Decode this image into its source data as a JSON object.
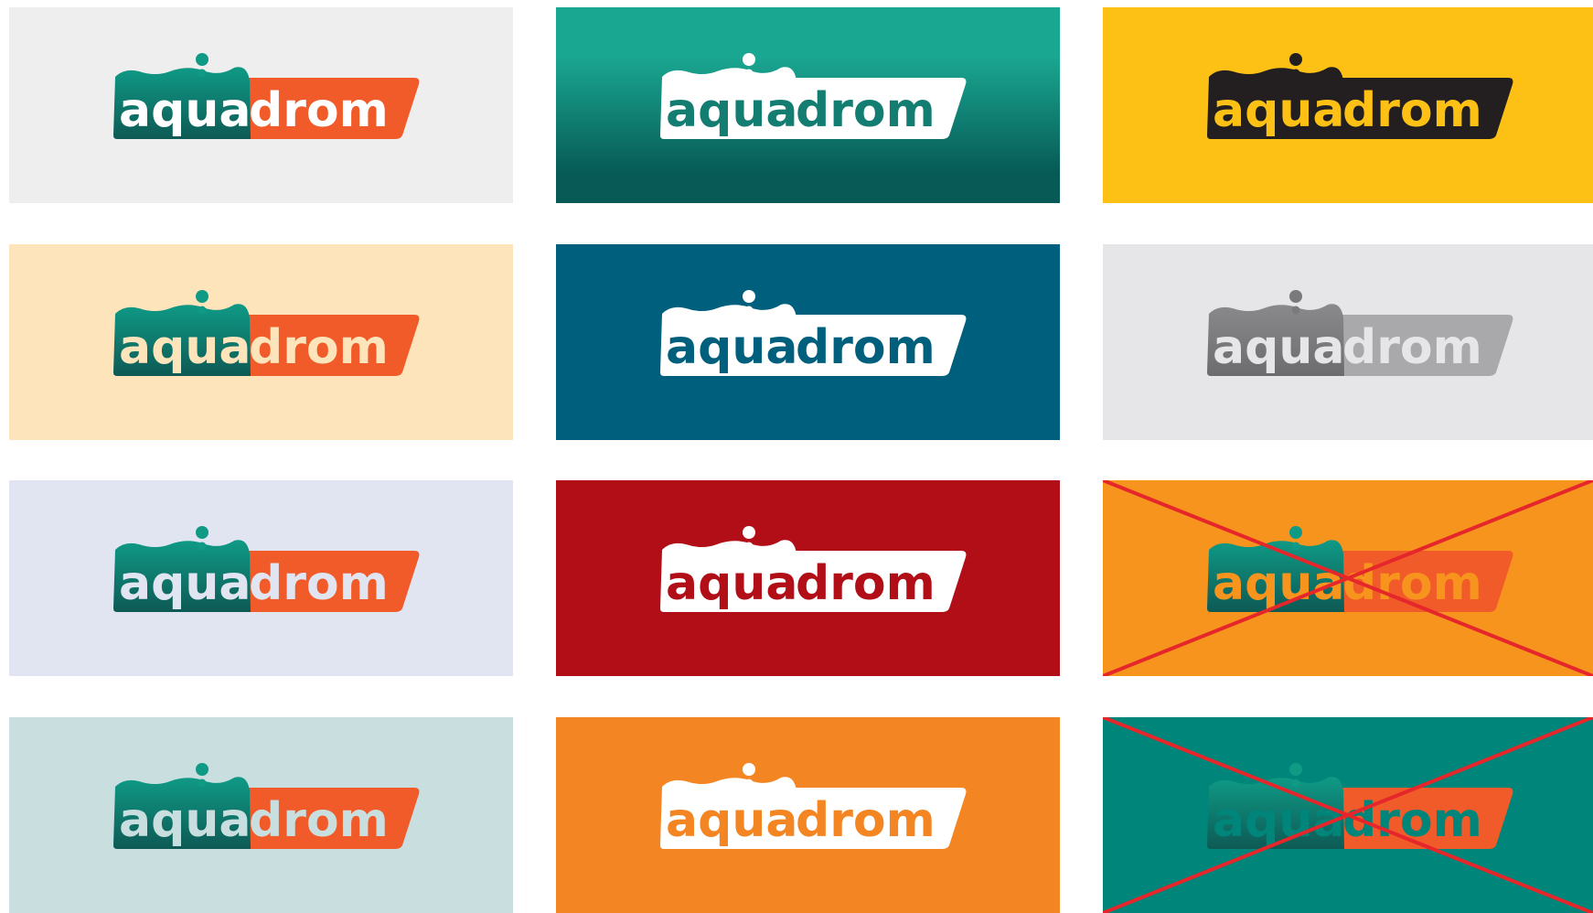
{
  "logo": {
    "part1": "aqua",
    "part2": "drom"
  },
  "tiles": [
    {
      "variant": "color on light gray",
      "bg": "#eeeeee",
      "a": "#0f9a86",
      "b": "#0e5a55",
      "r": "#f15a29",
      "t1": "#ffffff",
      "t2": "#ffffff",
      "drop": "#0f9a86",
      "crossed": false
    },
    {
      "variant": "white on teal gradient",
      "bg": "#1aa791",
      "bg2": "#075a56",
      "a": "#ffffff",
      "b": "#ffffff",
      "r": "#ffffff",
      "t1": "#137d72",
      "t2": "#137d72",
      "drop": "#ffffff",
      "crossed": false
    },
    {
      "variant": "black on yellow",
      "bg": "#fcc114",
      "a": "#231f20",
      "b": "#231f20",
      "r": "#231f20",
      "t1": "#fcc114",
      "t2": "#fcc114",
      "drop": "#231f20",
      "crossed": false
    },
    {
      "variant": "color on peach",
      "bg": "#fee4bb",
      "a": "#0f9a86",
      "b": "#0e5a55",
      "r": "#f15a29",
      "t1": "#fee4bb",
      "t2": "#fee4bb",
      "drop": "#0f9a86",
      "crossed": false
    },
    {
      "variant": "white on petrol blue",
      "bg": "#005f7d",
      "a": "#ffffff",
      "b": "#ffffff",
      "r": "#ffffff",
      "t1": "#005f7d",
      "t2": "#005f7d",
      "drop": "#ffffff",
      "crossed": false
    },
    {
      "variant": "grayscale on light gray",
      "bg": "#e6e6e8",
      "a": "#8a8a8c",
      "b": "#6c6c6e",
      "r": "#a9a9ab",
      "t1": "#e6e6e8",
      "t2": "#e6e6e8",
      "drop": "#7a7a7c",
      "crossed": false
    },
    {
      "variant": "color on lavender",
      "bg": "#e1e5f2",
      "a": "#0f9a86",
      "b": "#0e5a55",
      "r": "#f15a29",
      "t1": "#e1e5f2",
      "t2": "#e1e5f2",
      "drop": "#0f9a86",
      "crossed": false
    },
    {
      "variant": "white on red",
      "bg": "#b10e17",
      "a": "#ffffff",
      "b": "#ffffff",
      "r": "#ffffff",
      "t1": "#b10e17",
      "t2": "#b10e17",
      "drop": "#ffffff",
      "crossed": false
    },
    {
      "variant": "incorrect: color on orange",
      "bg": "#f7941d",
      "a": "#0f9a86",
      "b": "#0e5a55",
      "r": "#f15a29",
      "t1": "#f7941d",
      "t2": "#f7941d",
      "drop": "#0f9a86",
      "crossed": true
    },
    {
      "variant": "color on pale teal",
      "bg": "#c9dfdf",
      "a": "#0f9a86",
      "b": "#0e5a55",
      "r": "#f15a29",
      "t1": "#c9dfdf",
      "t2": "#c9dfdf",
      "drop": "#0f9a86",
      "crossed": false
    },
    {
      "variant": "white on orange",
      "bg": "#f38522",
      "a": "#ffffff",
      "b": "#ffffff",
      "r": "#ffffff",
      "t1": "#f38522",
      "t2": "#f38522",
      "drop": "#ffffff",
      "crossed": false
    },
    {
      "variant": "incorrect: color on teal",
      "bg": "#00857a",
      "a": "#0f9a86",
      "b": "#0e5a55",
      "r": "#f15a29",
      "t1": "#00857a",
      "t2": "#00857a",
      "drop": "#0f9a86",
      "crossed": true
    }
  ],
  "cross_color": "#e5262b"
}
